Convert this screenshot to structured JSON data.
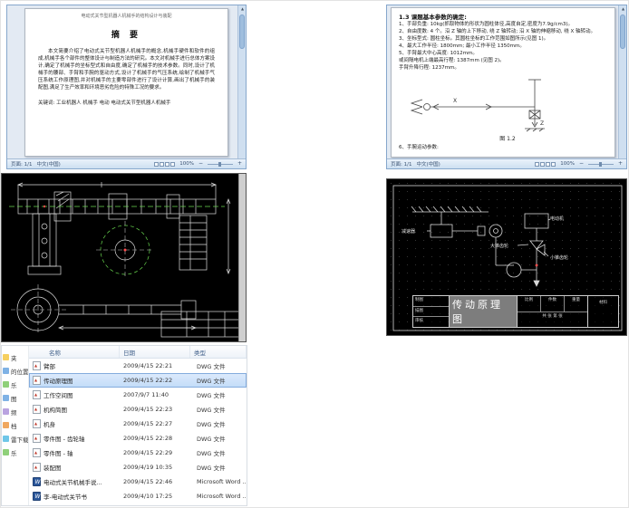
{
  "word_left": {
    "page_header": "电动式关节型机器人机械手的结构设计与装配",
    "title": "摘  要",
    "body": "本文简要介绍了电动式关节型机器人机械手的概念,机械手硬件和软件的组成,机械手各个部件的整体设计与制造方法的研究。本文对机械手进行总体方案设计,确定了机械手的坐标型式和自由度,确定了机械手的技术参数。同时,设计了机械手的腰部、手臂和手腕的驱动方式,设计了机械手的气压系统,绘制了机械手气压系统工作原理图,并对机械手的主要零部件进行了设计计算,画出了机械手的装配图,满足了生产效率和环境恶劣危险的特殊工况的要求。",
    "keywords": "关键词: 工业机器人 机械手 电动  电动式关节型机器人机械手",
    "status_page": "页面: 1/1",
    "status_lang": "中文(中国)",
    "zoom": "100%"
  },
  "word_right": {
    "heading": "1.3 课题基本参数的确定:",
    "items": [
      "1、手部负重: 10kg(抓取物体的形状为圆柱体径,高度自定,密度为7.9g/cm3)。",
      "2、自由度数: 4 个。沿 Z 轴的上下移动, 绕 Z 轴转动; 沿 X 轴的伸缩移动, 绕 X 轴转动。",
      "3、坐标型式: 圆柱坐标。其圆柱坐标的工作范围如图所示(见图 1)。",
      "4、最大工作半径: 1800mm; 最小工作半径 1350mm。",
      "5、手臂最大中心高度: 1012mm。",
      "或间隔电机上端最高行程: 1387mm (见图 2)。",
      "手臂升降行程: 1237mm。"
    ],
    "axis_x": "X",
    "axis_z": "Z",
    "figure_caption": "图 1.2",
    "next_item": "6、手腕运动参数:",
    "status_page": "页面: 1/1",
    "status_lang": "中文(中国)",
    "zoom": "100%"
  },
  "cad_right": {
    "labels": {
      "motor": "电动机",
      "reducer": "减速器",
      "big_gear": "大锥齿轮",
      "small_gear": "小锥齿轮"
    },
    "title_block": {
      "title": "传动原理图",
      "scale": "比例",
      "qty": "件数",
      "weight": "重量",
      "sheet": "共 张 第 张",
      "material": "材料",
      "draw": "制图",
      "trace": "描图",
      "check": "审核"
    }
  },
  "explorer": {
    "columns": {
      "name": "名称",
      "date": "日期",
      "type": "类型"
    },
    "rows": [
      {
        "name": "臂部",
        "date": "2009/4/15 22:21",
        "type": "DWG 文件",
        "icon": "dwg",
        "selected": false
      },
      {
        "name": "传动原理图",
        "date": "2009/4/15 22:22",
        "type": "DWG 文件",
        "icon": "dwg",
        "selected": true
      },
      {
        "name": "工作空间图",
        "date": "2007/9/7 11:40",
        "type": "DWG 文件",
        "icon": "dwg",
        "selected": false
      },
      {
        "name": "机构简图",
        "date": "2009/4/15 22:23",
        "type": "DWG 文件",
        "icon": "dwg",
        "selected": false
      },
      {
        "name": "机身",
        "date": "2009/4/15 22:27",
        "type": "DWG 文件",
        "icon": "dwg",
        "selected": false
      },
      {
        "name": "零件图 - 齿轮轴",
        "date": "2009/4/15 22:28",
        "type": "DWG 文件",
        "icon": "dwg",
        "selected": false
      },
      {
        "name": "零件图 - 轴",
        "date": "2009/4/15 22:29",
        "type": "DWG 文件",
        "icon": "dwg",
        "selected": false
      },
      {
        "name": "装配图",
        "date": "2009/4/19 10:35",
        "type": "DWG 文件",
        "icon": "dwg",
        "selected": false
      },
      {
        "name": "电动式关节机械手说...",
        "date": "2009/4/15 22:46",
        "type": "Microsoft Word ...",
        "icon": "word",
        "selected": false
      },
      {
        "name": "李-电动式关节书",
        "date": "2009/4/10 17:25",
        "type": "Microsoft Word ...",
        "icon": "word",
        "selected": false
      }
    ],
    "sidebar": [
      "夹",
      "的位置",
      "乐",
      "图",
      "频",
      "档",
      "雷下载",
      "乐"
    ]
  }
}
